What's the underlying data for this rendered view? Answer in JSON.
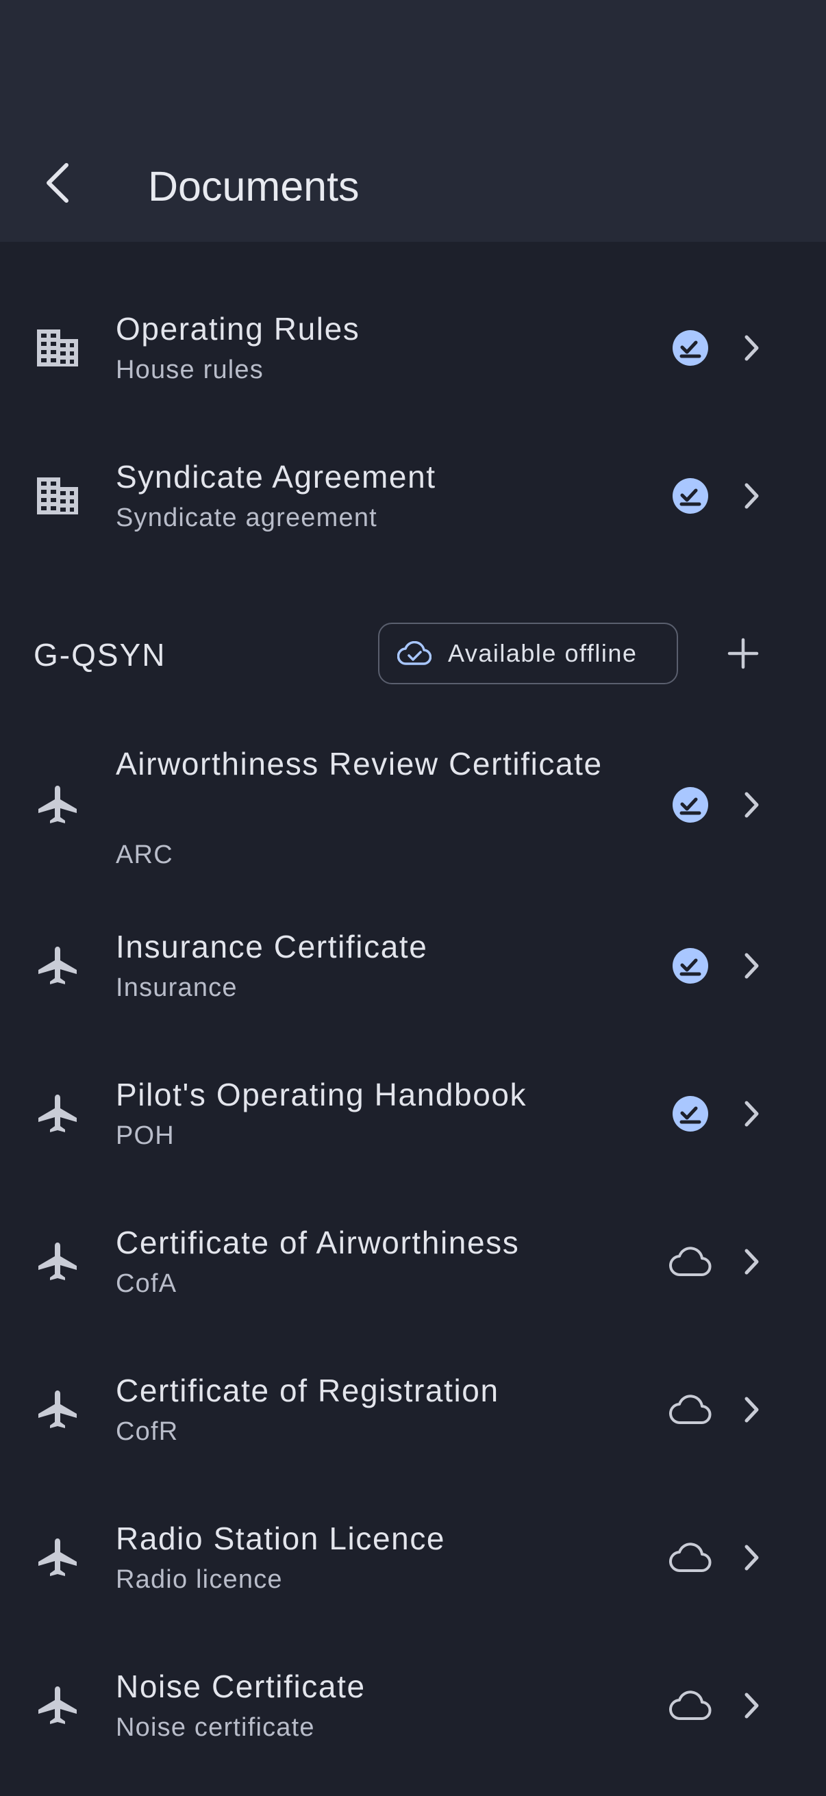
{
  "header": {
    "title": "Documents"
  },
  "clipped_heading": "documents",
  "club_documents": [
    {
      "title": "Operating Rules",
      "subtitle": "House rules",
      "status": "downloaded"
    },
    {
      "title": "Syndicate Agreement",
      "subtitle": "Syndicate agreement",
      "status": "downloaded"
    }
  ],
  "aircraft_section": {
    "label": "G-QSYN",
    "offline_chip": "Available offline"
  },
  "aircraft_documents": [
    {
      "title": "Airworthiness Review Certificate",
      "subtitle": "ARC",
      "status": "downloaded"
    },
    {
      "title": "Insurance Certificate",
      "subtitle": "Insurance",
      "status": "downloaded"
    },
    {
      "title": "Pilot's Operating Handbook",
      "subtitle": "POH",
      "status": "downloaded"
    },
    {
      "title": "Certificate of Airworthiness",
      "subtitle": "CofA",
      "status": "cloud"
    },
    {
      "title": "Certificate of Registration",
      "subtitle": "CofR",
      "status": "cloud"
    },
    {
      "title": "Radio Station Licence",
      "subtitle": "Radio licence",
      "status": "cloud"
    },
    {
      "title": "Noise Certificate",
      "subtitle": "Noise certificate",
      "status": "cloud"
    }
  ],
  "colors": {
    "background": "#1d202b",
    "app_bar": "#262a37",
    "accent": "#a9c7ff",
    "icon_grey": "#c9ccd6"
  },
  "icons": {
    "back": "back-arrow-icon",
    "club_item": "building-icon",
    "aircraft_item": "airplane-icon",
    "downloaded": "offline-check-icon",
    "cloud": "cloud-icon",
    "chevron": "chevron-right-icon",
    "add": "plus-icon",
    "chip": "cloud-done-icon"
  }
}
